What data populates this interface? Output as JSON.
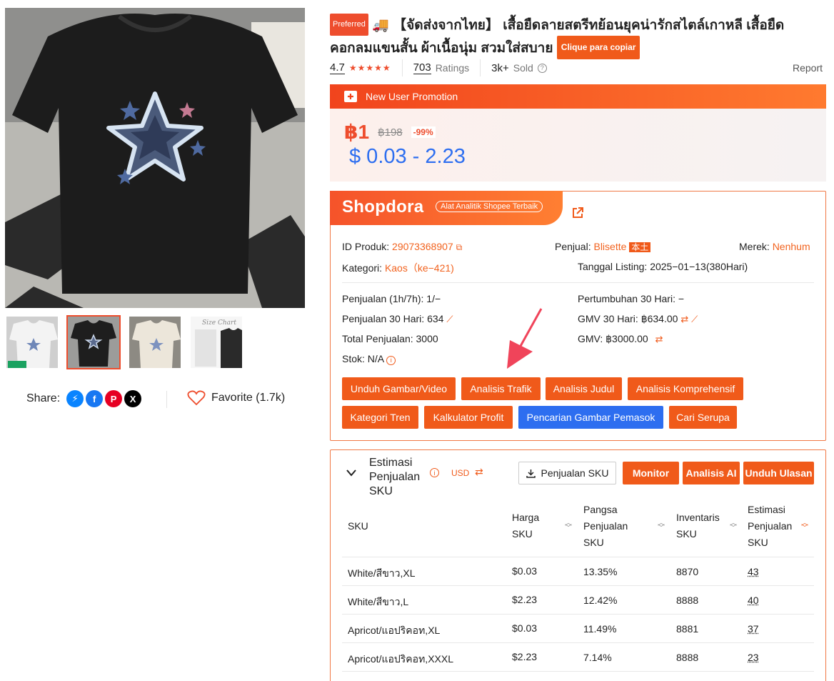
{
  "gallery": {
    "share_label": "Share:",
    "favorite_label": "Favorite (1.7k)",
    "thumbs": [
      "white-tee",
      "black-tee",
      "cream-tee",
      "size-chart"
    ],
    "size_chart_label": "Size Chart"
  },
  "product": {
    "preferred_badge": "Preferred",
    "title": "🚚 【จัดส่งจากไทย】 เสื้อยืดลายสตรีทย้อนยุคน่ารักสไตล์เกาหลี เสื้อยืดคอกลมแขนสั้น ผ้าเนื้อนุ่ม สวมใส่สบาย",
    "copy_button": "Clique para copiar",
    "rating": "4.7",
    "stars": "★★★★★",
    "ratings_count": "703",
    "ratings_label": "Ratings",
    "sold_count": "3k+",
    "sold_label": "Sold",
    "report_label": "Report"
  },
  "promo": {
    "label": "New User Promotion",
    "price": "฿1",
    "original_price": "฿198",
    "discount": "-99%",
    "usd_range": "$ 0.03 - 2.23"
  },
  "shopdora": {
    "logo": "Shopdora",
    "tagline": "Alat Analitik Shopee Terbaik",
    "id_label": "ID Produk:",
    "id_value": "29073368907",
    "seller_label": "Penjual:",
    "seller_value": "Blisette",
    "seller_badge": "本土",
    "brand_label": "Merek:",
    "brand_value": "Nenhum",
    "category_label": "Kategori:",
    "category_value": "Kaos（ke−421)",
    "listing_label": "Tanggal Listing:",
    "listing_value": "2025−01−13(380Hari)",
    "sales_1h7h": "Penjualan (1h/7h): 1/−",
    "growth_30": "Pertumbuhan 30 Hari: −",
    "sales_30": "Penjualan 30 Hari: 634",
    "gmv_30": "GMV 30 Hari: ฿634.00",
    "total_sales": "Total Penjualan: 3000",
    "gmv": "GMV: ฿3000.00",
    "stock": "Stok: N/A",
    "buttons_row1": [
      "Unduh Gambar/Video",
      "Analisis Trafik",
      "Analisis Judul",
      "Analisis Komprehensif"
    ],
    "buttons_row2": [
      "Kategori Tren",
      "Kalkulator Profit",
      "Pencarian Gambar Pemasok",
      "Cari Serupa"
    ]
  },
  "sku_panel": {
    "title_line1": "Estimasi",
    "title_line2": "Penjualan",
    "title_line3": "SKU",
    "currency": "USD",
    "btn_sales": "Penjualan SKU",
    "btn_monitor": "Monitor",
    "btn_ai": "Analisis AI",
    "btn_reviews": "Unduh Ulasan",
    "headers": {
      "sku": "SKU",
      "price": [
        "Harga",
        "SKU"
      ],
      "share": [
        "Pangsa",
        "Penjualan",
        "SKU"
      ],
      "inventory": [
        "Inventaris",
        "SKU"
      ],
      "estimate": [
        "Estimasi",
        "Penjualan",
        "SKU"
      ]
    },
    "rows": [
      {
        "sku": "White/สีขาว,XL",
        "price": "$0.03",
        "share": "13.35%",
        "inv": "8870",
        "est": "43"
      },
      {
        "sku": "White/สีขาว,L",
        "price": "$2.23",
        "share": "12.42%",
        "inv": "8888",
        "est": "40"
      },
      {
        "sku": "Apricot/แอปริคอท,XL",
        "price": "$0.03",
        "share": "11.49%",
        "inv": "8881",
        "est": "37"
      },
      {
        "sku": "Apricot/แอปริคอท,XXXL",
        "price": "$2.23",
        "share": "7.14%",
        "inv": "8888",
        "est": "23"
      }
    ]
  },
  "colors": {
    "accent": "#ee4d2d",
    "orange": "#f05a1a",
    "blue": "#2d6ef0"
  }
}
